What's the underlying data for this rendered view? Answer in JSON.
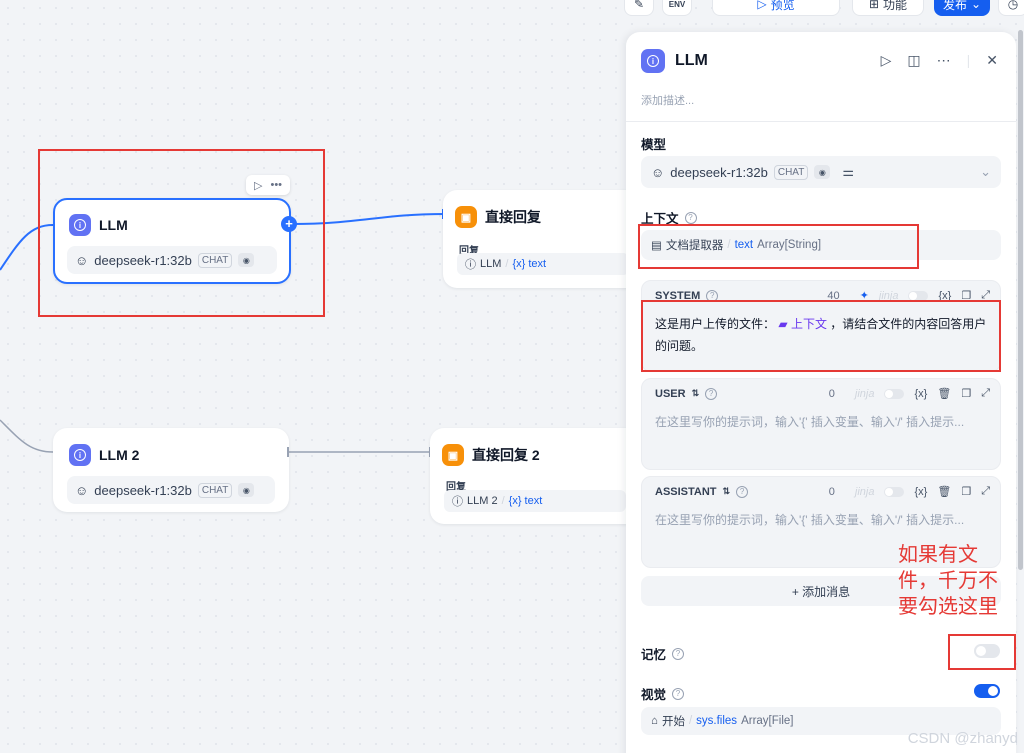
{
  "toolbar": {
    "preview_label": "预览",
    "feature_label": "功能",
    "publish_label": "发布",
    "env_label": "ENV"
  },
  "nodes": {
    "llm1": {
      "title": "LLM",
      "model": "deepseek-r1:32b",
      "mode": "CHAT"
    },
    "reply1": {
      "title": "直接回复",
      "reply_label": "回复",
      "src_node": "LLM",
      "sep": "/",
      "var": "{x} text"
    },
    "llm2": {
      "title": "LLM 2",
      "model": "deepseek-r1:32b",
      "mode": "CHAT"
    },
    "reply2": {
      "title": "直接回复 2",
      "reply_label": "回复",
      "src_node": "LLM 2",
      "sep": "/",
      "var": "{x} text"
    }
  },
  "panel": {
    "title": "LLM",
    "description_placeholder": "添加描述...",
    "model_label": "模型",
    "model": {
      "name": "deepseek-r1:32b",
      "mode": "CHAT"
    },
    "context_label": "上下文",
    "context": {
      "node": "文档提取器",
      "sep": "/",
      "var": "text",
      "type": "Array[String]"
    },
    "system": {
      "label": "SYSTEM",
      "count": "40",
      "jinja": "jinja",
      "var_icon": "{x}",
      "text_before": "这是用户上传的文件：",
      "chip": "上下文",
      "text_after": "，请结合文件的内容回答用户的问题。"
    },
    "user": {
      "label": "USER",
      "count": "0",
      "jinja": "jinja",
      "var_icon": "{x}",
      "placeholder": "在这里写你的提示词，输入'{' 插入变量、输入'/' 插入提示..."
    },
    "assistant": {
      "label": "ASSISTANT",
      "count": "0",
      "jinja": "jinja",
      "var_icon": "{x}",
      "placeholder": "在这里写你的提示词，输入'{' 插入变量、输入'/' 插入提示..."
    },
    "add_message": "+ 添加消息",
    "memory_label": "记忆",
    "memory_enabled": false,
    "vision_label": "视觉",
    "vision_enabled": true,
    "vision_var": {
      "node": "开始",
      "sep": "/",
      "var": "sys.files",
      "type": "Array[File]"
    }
  },
  "annotation": {
    "text": "如果有文件，千万不要勾选这里"
  },
  "watermark": "CSDN @zhanyd",
  "colors": {
    "accent": "#155eef",
    "annotation": "#e53935",
    "llm_icon": "#6172f3",
    "reply_icon": "#f79009"
  }
}
